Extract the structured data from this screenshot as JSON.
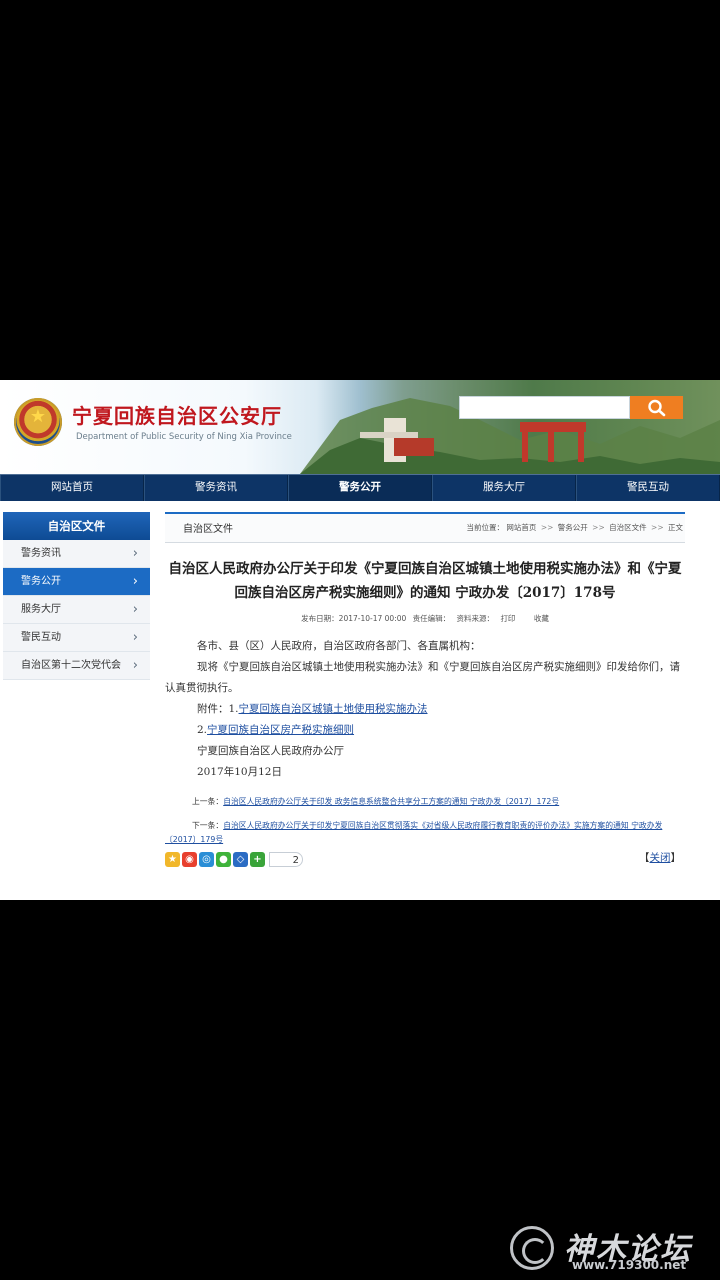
{
  "header": {
    "site_title": "宁夏回族自治区公安厅",
    "site_subtitle": "Department of Public Security of Ning Xia Province",
    "search_placeholder": "",
    "search_icon": "search-icon"
  },
  "nav": {
    "items": [
      {
        "label": "网站首页"
      },
      {
        "label": "警务资讯"
      },
      {
        "label": "警务公开"
      },
      {
        "label": "服务大厅"
      },
      {
        "label": "警民互动"
      }
    ]
  },
  "sidebar": {
    "header": "自治区文件",
    "items": [
      {
        "label": "警务资讯",
        "arrow": "›"
      },
      {
        "label": "警务公开",
        "arrow": "›"
      },
      {
        "label": "服务大厅",
        "arrow": "›"
      },
      {
        "label": "警民互动",
        "arrow": "›"
      },
      {
        "label": "自治区第十二次党代会",
        "arrow": "›"
      }
    ]
  },
  "main": {
    "tab": "自治区文件",
    "breadcrumb": {
      "prefix": "当前位置：",
      "items": [
        "网站首页",
        "警务公开",
        "自治区文件",
        "正文"
      ],
      "separator": ">>"
    },
    "title": "自治区人民政府办公厅关于印发《宁夏回族自治区城镇土地使用税实施办法》和《宁夏回族自治区房产税实施细则》的通知 宁政办发〔2017〕178号",
    "meta": {
      "date": "发布日期：2017-10-17 00:00",
      "editor": "责任编辑：",
      "source": "资料来源：",
      "print": "打印",
      "favorite": "收藏"
    },
    "body": {
      "salutation": "各市、县（区）人民政府，自治区政府各部门、各直属机构：",
      "paragraph": "现将《宁夏回族自治区城镇土地使用税实施办法》和《宁夏回族自治区房产税实施细则》印发给你们，请认真贯彻执行。",
      "attachment_label": "附件：1.",
      "attachment_1": "宁夏回族自治区城镇土地使用税实施办法",
      "attachment_2_num": "2.",
      "attachment_2": "宁夏回族自治区房产税实施细则",
      "signature": "宁夏回族自治区人民政府办公厅",
      "date": "2017年10月12日"
    },
    "prev": {
      "label": "上一条：",
      "text": "自治区人民政府办公厅关于印发 政务信息系统整合共享分工方案的通知  宁政办发〔2017〕172号"
    },
    "next": {
      "label": "下一条：",
      "text": "自治区人民政府办公厅关于印发宁夏回族自治区贯彻落实《对省级人民政府履行教育职责的评价办法》实施方案的通知  宁政办发〔2017〕179号"
    },
    "share": {
      "icons": [
        "qzone-icon",
        "weibo-icon",
        "tencent-weibo-icon",
        "wechat-icon",
        "renren-icon",
        "more-share-icon"
      ],
      "count": "2"
    },
    "close": {
      "left": "【",
      "label": "关闭",
      "right": "】"
    }
  },
  "watermark": {
    "text": "神木论坛",
    "url": "www.719300.net"
  },
  "colors": {
    "nav_bg": "#0d3466",
    "accent_blue": "#1c6bc4",
    "title_red": "#c0171e",
    "search_orange": "#ef7e21",
    "link": "#1f4fa0"
  }
}
